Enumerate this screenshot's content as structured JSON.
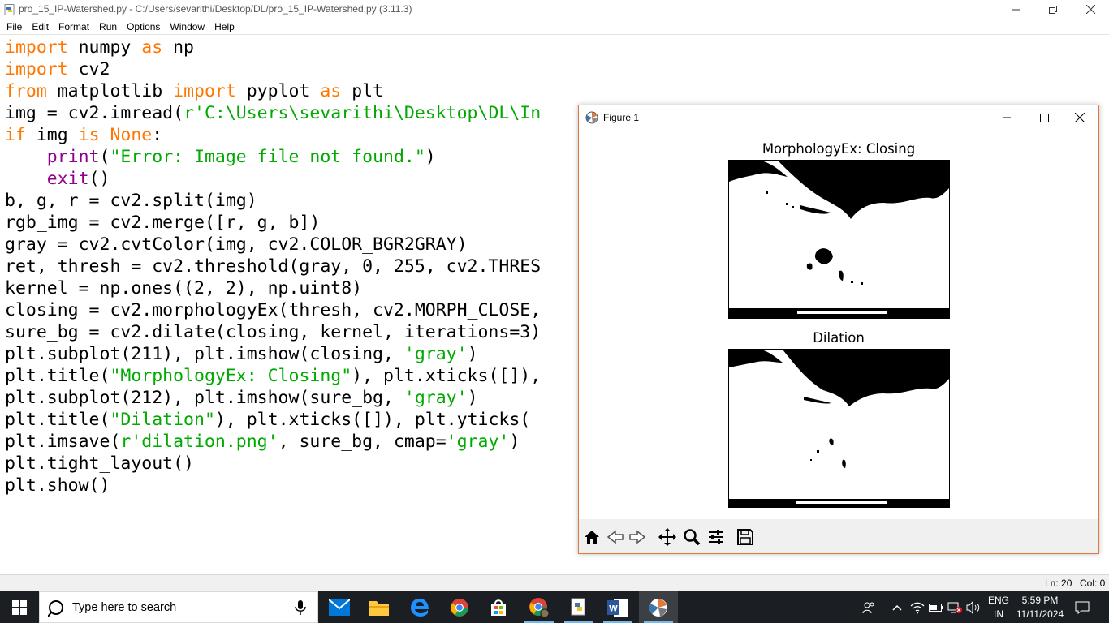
{
  "window": {
    "title": "pro_15_IP-Watershed.py - C:/Users/sevarithi/Desktop/DL/pro_15_IP-Watershed.py (3.11.3)"
  },
  "menu": [
    "File",
    "Edit",
    "Format",
    "Run",
    "Options",
    "Window",
    "Help"
  ],
  "code_lines": [
    [
      {
        "t": "import",
        "c": "kw"
      },
      {
        "t": " numpy "
      },
      {
        "t": "as",
        "c": "kw"
      },
      {
        "t": " np"
      }
    ],
    [
      {
        "t": "import",
        "c": "kw"
      },
      {
        "t": " cv2"
      }
    ],
    [
      {
        "t": "from",
        "c": "kw"
      },
      {
        "t": " matplotlib "
      },
      {
        "t": "import",
        "c": "kw"
      },
      {
        "t": " pyplot "
      },
      {
        "t": "as",
        "c": "kw"
      },
      {
        "t": " plt"
      }
    ],
    [
      {
        "t": "img = cv2.imread("
      },
      {
        "t": "r'C:\\Users\\sevarithi\\Desktop\\DL\\In",
        "c": "st"
      }
    ],
    [
      {
        "t": "if",
        "c": "kw"
      },
      {
        "t": " img "
      },
      {
        "t": "is",
        "c": "kw"
      },
      {
        "t": " "
      },
      {
        "t": "None",
        "c": "kw"
      },
      {
        "t": ":"
      }
    ],
    [
      {
        "t": "    "
      },
      {
        "t": "print",
        "c": "bi"
      },
      {
        "t": "("
      },
      {
        "t": "\"Error: Image file not found.\"",
        "c": "st"
      },
      {
        "t": ")"
      }
    ],
    [
      {
        "t": "    "
      },
      {
        "t": "exit",
        "c": "bi"
      },
      {
        "t": "()"
      }
    ],
    [
      {
        "t": "b, g, r = cv2.split(img)"
      }
    ],
    [
      {
        "t": "rgb_img = cv2.merge([r, g, b])"
      }
    ],
    [
      {
        "t": "gray = cv2.cvtColor(img, cv2.COLOR_BGR2GRAY)"
      }
    ],
    [
      {
        "t": "ret, thresh = cv2.threshold(gray, 0, 255, cv2.THRES"
      }
    ],
    [
      {
        "t": "kernel = np.ones((2, 2), np.uint8)"
      }
    ],
    [
      {
        "t": "closing = cv2.morphologyEx(thresh, cv2.MORPH_CLOSE,"
      }
    ],
    [
      {
        "t": "sure_bg = cv2.dilate(closing, kernel, iterations=3)"
      }
    ],
    [
      {
        "t": "plt.subplot(211), plt.imshow(closing, "
      },
      {
        "t": "'gray'",
        "c": "st"
      },
      {
        "t": ")"
      }
    ],
    [
      {
        "t": "plt.title("
      },
      {
        "t": "\"MorphologyEx: Closing\"",
        "c": "st"
      },
      {
        "t": "), plt.xticks([]),"
      }
    ],
    [
      {
        "t": "plt.subplot(212), plt.imshow(sure_bg, "
      },
      {
        "t": "'gray'",
        "c": "st"
      },
      {
        "t": ")"
      }
    ],
    [
      {
        "t": "plt.title("
      },
      {
        "t": "\"Dilation\"",
        "c": "st"
      },
      {
        "t": "), plt.xticks([]), plt.yticks("
      }
    ],
    [
      {
        "t": "plt.imsave("
      },
      {
        "t": "r'dilation.png'",
        "c": "st"
      },
      {
        "t": ", sure_bg, cmap="
      },
      {
        "t": "'gray'",
        "c": "st"
      },
      {
        "t": ")"
      }
    ],
    [
      {
        "t": "plt.tight_layout()"
      }
    ],
    [
      {
        "t": "plt.show()"
      }
    ]
  ],
  "syntax_colors": {
    "keyword": "#ff7700",
    "builtin": "#900090",
    "string": "#00aa00"
  },
  "status": {
    "line": "Ln: 20",
    "col": "Col: 0"
  },
  "figure": {
    "title": "Figure 1",
    "subplot1_title": "MorphologyEx: Closing",
    "subplot2_title": "Dilation",
    "toolbar": [
      "home-icon",
      "back-icon",
      "forward-icon",
      "pan-icon",
      "zoom-icon",
      "configure-icon",
      "save-icon"
    ]
  },
  "taskbar": {
    "search_placeholder": "Type here to search",
    "apps": [
      "mail-icon",
      "file-explorer-icon",
      "edge-icon",
      "chrome-icon",
      "store-icon",
      "chrome-profile-icon",
      "python-icon",
      "word-icon",
      "matplotlib-icon"
    ],
    "language": "ENG",
    "region": "IN",
    "time": "5:59 PM",
    "date": "11/11/2024"
  }
}
